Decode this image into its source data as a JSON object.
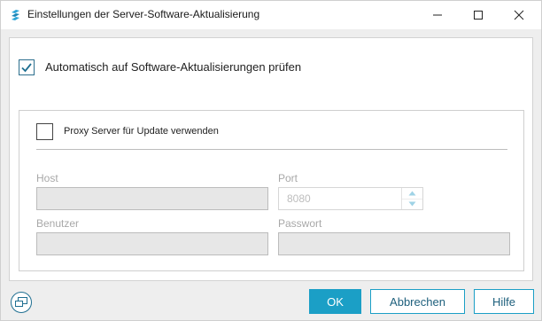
{
  "window": {
    "title": "Einstellungen der Server-Software-Aktualisierung"
  },
  "options": {
    "auto_check_label": "Automatisch auf Software-Aktualisierungen prüfen",
    "auto_check_checked": true,
    "proxy_label": "Proxy Server für Update verwenden",
    "proxy_checked": false
  },
  "proxy": {
    "host_label": "Host",
    "host_value": "",
    "port_label": "Port",
    "port_value": "8080",
    "user_label": "Benutzer",
    "user_value": "",
    "password_label": "Passwort",
    "password_value": ""
  },
  "buttons": {
    "ok": "OK",
    "cancel": "Abbrechen",
    "help": "Hilfe"
  },
  "colors": {
    "accent": "#1b9fc6",
    "disabled_field": "#e7e7e7"
  },
  "icons": {
    "app": "app-logo-icon",
    "minimize": "minimize-icon",
    "maximize": "maximize-icon",
    "close": "close-icon",
    "checkmark": "checkmark-icon",
    "spin_up": "spin-up-icon",
    "spin_down": "spin-down-icon",
    "screen": "screen-window-icon"
  }
}
